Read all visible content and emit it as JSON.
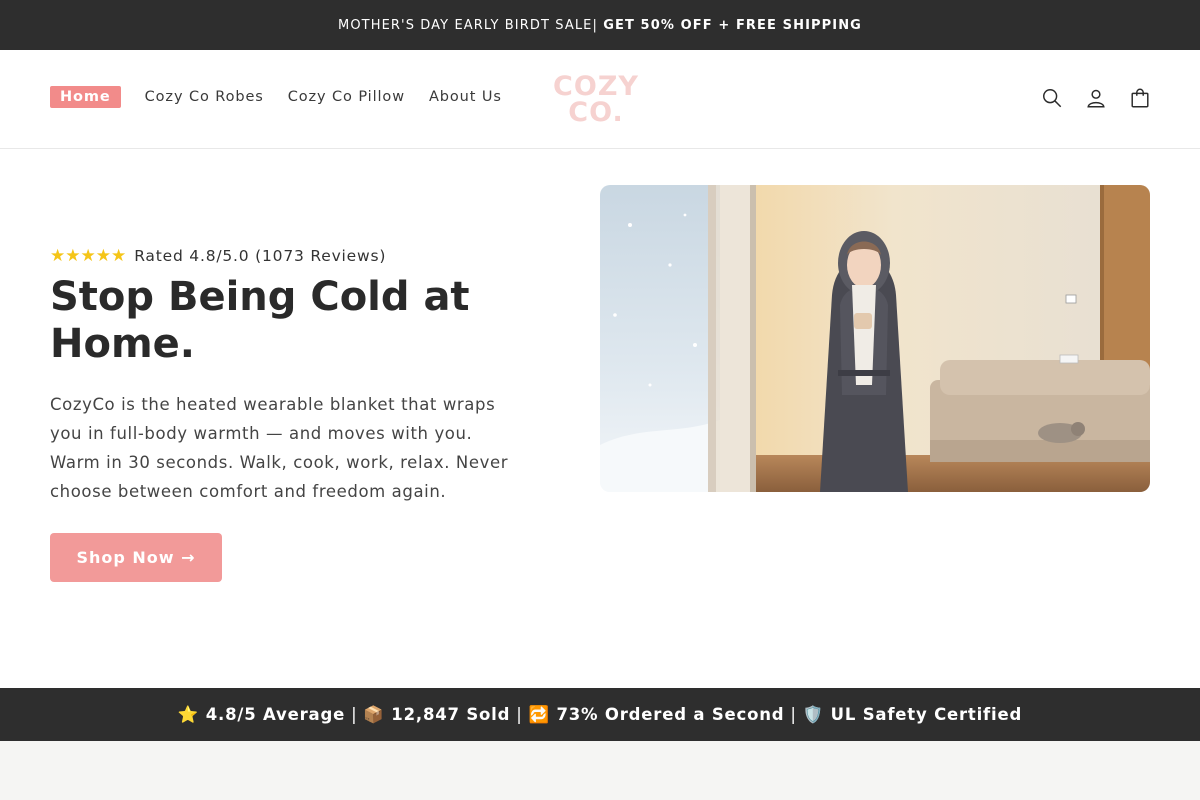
{
  "announcement": {
    "text": "MOTHER'S DAY EARLY BIRDT SALE|",
    "highlight": "GET 50% OFF + FREE SHIPPING"
  },
  "nav": {
    "items": [
      {
        "label": "Home",
        "active": true
      },
      {
        "label": "Cozy Co Robes"
      },
      {
        "label": "Cozy Co Pillow"
      },
      {
        "label": "About Us"
      }
    ]
  },
  "logo": {
    "line1": "COZY",
    "line2": "CO."
  },
  "header_icons": [
    "search-icon",
    "account-icon",
    "cart-icon"
  ],
  "hero": {
    "stars": "★★★★★",
    "rating_text": "Rated 4.8/5.0 (1073 Reviews)",
    "title": "Stop Being Cold at Home.",
    "description": "CozyCo is the heated wearable blanket that wraps you in full-body warmth — and moves with you. Warm in 30 seconds. Walk, cook, work, relax. Never choose between comfort and freedom again.",
    "cta": "Shop Now →"
  },
  "stats": [
    "⭐ 4.8/5 Average",
    "📦 12,847 Sold",
    "🔁 73% Ordered a Second",
    "🛡️ UL Safety Certified"
  ],
  "colors": {
    "accent": "#f28b8a",
    "dark_band": "#2e2e2e",
    "logo": "#f6d2d0",
    "star": "#f5c518"
  }
}
